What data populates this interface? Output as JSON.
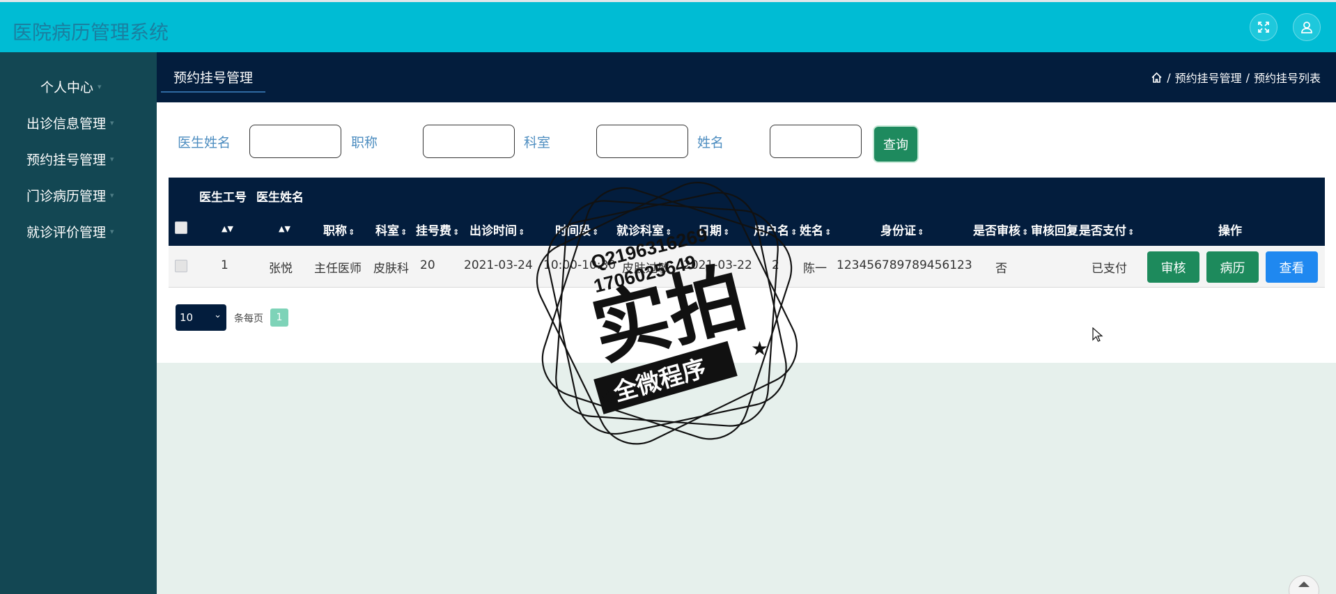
{
  "app": {
    "title": "医院病历管理系统"
  },
  "sidebar": {
    "items": [
      {
        "label": "个人中心"
      },
      {
        "label": "出诊信息管理"
      },
      {
        "label": "预约挂号管理"
      },
      {
        "label": "门诊病历管理"
      },
      {
        "label": "就诊评价管理"
      }
    ]
  },
  "nav": {
    "active_tab": "预约挂号管理",
    "breadcrumb": [
      "预约挂号管理",
      "预约挂号列表"
    ],
    "breadcrumb_sep": "/"
  },
  "filters": [
    {
      "label": "医生姓名",
      "value": ""
    },
    {
      "label": "职称",
      "value": ""
    },
    {
      "label": "科室",
      "value": ""
    },
    {
      "label": "姓名",
      "value": ""
    }
  ],
  "query_button": "查询",
  "table": {
    "group_headers": [
      "医生工号",
      "医生姓名"
    ],
    "columns": [
      "职称",
      "科室",
      "挂号费",
      "出诊时间",
      "时间段",
      "就诊科室",
      "日期",
      "用户名",
      "姓名",
      "身份证",
      "是否审核",
      "审核回复",
      "是否支付",
      "操作"
    ],
    "rows": [
      {
        "doctor_id": "1",
        "doctor_name": "张悦",
        "title": "主任医师",
        "department": "皮肤科",
        "fee": "20",
        "visit_time": "2021-03-24",
        "time_slot": "10:00-10:30",
        "visit_dept": "皮肤过敏",
        "date": "2021-03-22",
        "username": "2",
        "name": "陈一",
        "id_card": "123456789789456123",
        "reviewed": "否",
        "review_reply": "",
        "paid": "已支付",
        "actions": [
          "审核",
          "病历",
          "查看"
        ]
      }
    ]
  },
  "pagination": {
    "page_size": "10",
    "per_page_label": "条每页",
    "current_page": "1"
  },
  "watermark": {
    "qq1": "Q2196316269",
    "qq2": "1706025649",
    "main": "实拍",
    "sub": "全微程序"
  },
  "colors": {
    "header": "#00bcd4",
    "sidebar": "#134753",
    "navy": "#031d3d",
    "green": "#1d8a5c",
    "blue": "#1f88f0"
  }
}
